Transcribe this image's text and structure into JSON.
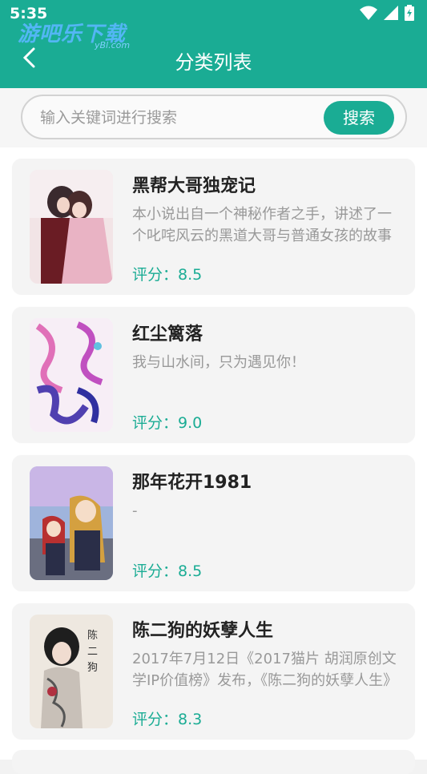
{
  "status_bar": {
    "time": "5:35"
  },
  "watermark": {
    "text": "游吧乐下载",
    "sub": "yBl.com"
  },
  "header": {
    "title": "分类列表"
  },
  "search": {
    "placeholder": "输入关键词进行搜索",
    "value": "",
    "button_label": "搜索"
  },
  "books": [
    {
      "title": "黑帮大哥独宠记",
      "desc": "本小说出自一个神秘作者之手，讲述了一个叱咤风云的黑道大哥与普通女孩的故事",
      "score": "评分：8.5"
    },
    {
      "title": "红尘篱落",
      "desc": "我与山水间，只为遇见你！",
      "score": "评分：9.0"
    },
    {
      "title": "那年花开1981",
      "desc": "-",
      "score": "评分：8.5"
    },
    {
      "title": "陈二狗的妖孽人生",
      "desc": "2017年7月12日《2017猫片 胡润原创文学IP价值榜》发布，《陈二狗的妖孽人生》",
      "score": "评分：8.3"
    }
  ],
  "colors": {
    "accent": "#1aac94"
  }
}
